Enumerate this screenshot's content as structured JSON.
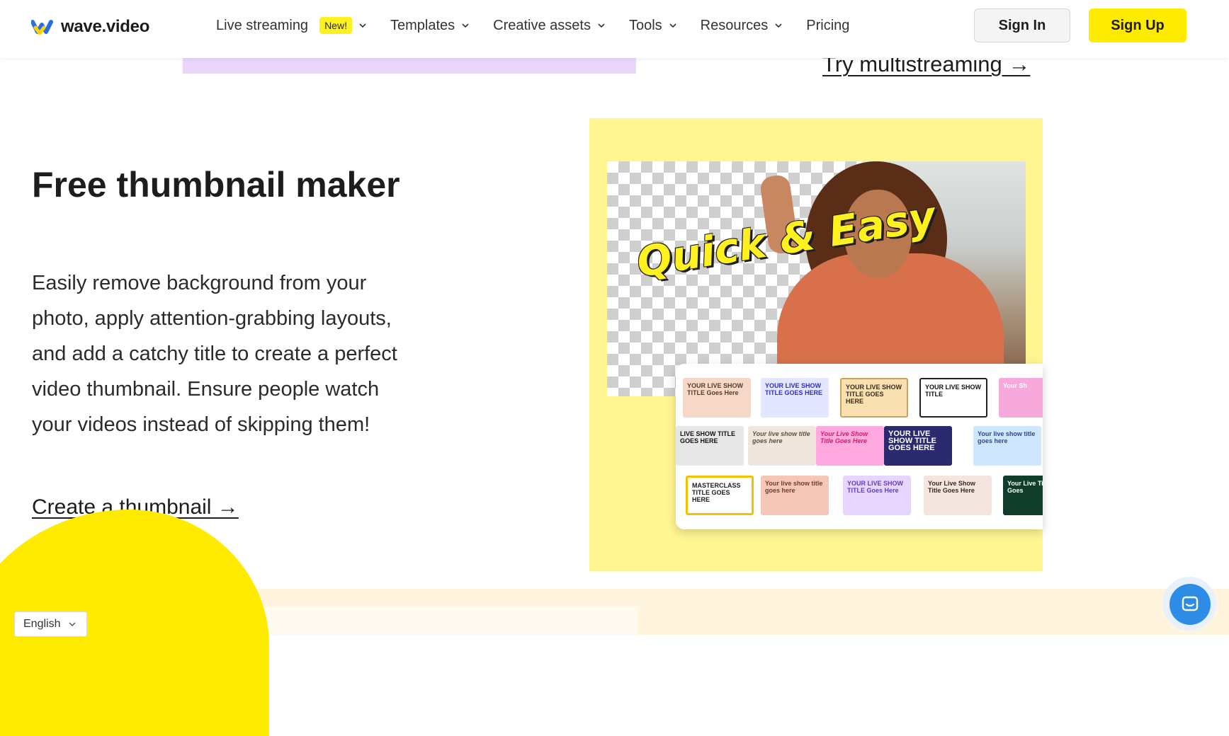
{
  "header": {
    "logo_text": "wave.video",
    "nav": [
      {
        "label": "Live streaming",
        "badge": "New!",
        "has_dropdown": true
      },
      {
        "label": "Templates",
        "has_dropdown": true
      },
      {
        "label": "Creative assets",
        "has_dropdown": true
      },
      {
        "label": "Tools",
        "has_dropdown": true
      },
      {
        "label": "Resources",
        "has_dropdown": true
      },
      {
        "label": "Pricing",
        "has_dropdown": false
      }
    ],
    "sign_in": "Sign In",
    "sign_up": "Sign Up"
  },
  "prev_section": {
    "link": "Try multistreaming →"
  },
  "section": {
    "title": "Free thumbnail maker",
    "description": "Easily remove background from your photo, apply attention-grabbing layouts, and add a catchy title to create a perfect video thumbnail. Ensure people watch your videos instead of skipping them!",
    "cta": "Create a thumbnail →",
    "hero_overlay_text": "Quick & Easy",
    "templates": [
      "YOUR LIVE SHOW TITLE Goes Here",
      "YOUR LIVE SHOW TITLE GOES HERE",
      "YOUR LIVE SHOW TITLE GOES HERE",
      "YOUR LIVE SHOW TITLE",
      "Your Sh",
      "LIVE SHOW TITLE GOES HERE",
      "Your live show title goes here",
      "Your Live Show Title Goes Here",
      "YOUR LIVE SHOW TITLE GOES HERE",
      "Your live show title goes here",
      "MASTERCLASS TITLE GOES HERE",
      "Your live show title goes here",
      "YOUR LIVE SHOW TITLE Goes Here",
      "Your Live Show Title Goes Here",
      "Your Live Title Goes"
    ]
  },
  "footer_controls": {
    "language": "English"
  },
  "colors": {
    "accent_yellow": "#ffeb00",
    "hero_bg": "#fff591",
    "chat_blue": "#2d8ce6"
  }
}
